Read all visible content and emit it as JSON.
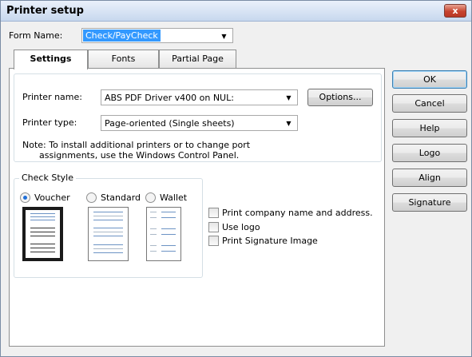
{
  "window": {
    "title": "Printer setup",
    "close_label": "x"
  },
  "form_name": {
    "label": "Form Name:",
    "value": "Check/PayCheck"
  },
  "tabs": [
    {
      "label": "Settings",
      "active": true
    },
    {
      "label": "Fonts",
      "active": false
    },
    {
      "label": "Partial Page",
      "active": false
    }
  ],
  "printer": {
    "name_label": "Printer name:",
    "name_value": "ABS PDF Driver v400 on NUL:",
    "type_label": "Printer type:",
    "type_value": "Page-oriented (Single sheets)",
    "options_label": "Options...",
    "note_line1": "Note: To install additional printers or to change port",
    "note_line2": "assignments, use the Windows Control Panel."
  },
  "check_style": {
    "caption": "Check Style",
    "options": [
      {
        "label": "Voucher",
        "selected": true
      },
      {
        "label": "Standard",
        "selected": false
      },
      {
        "label": "Wallet",
        "selected": false
      }
    ]
  },
  "checkboxes": [
    {
      "label": "Print company name and address.",
      "checked": false
    },
    {
      "label": "Use logo",
      "checked": false
    },
    {
      "label": "Print Signature Image",
      "checked": false
    }
  ],
  "buttons": {
    "ok": "OK",
    "cancel": "Cancel",
    "help": "Help",
    "logo": "Logo",
    "align": "Align",
    "signature": "Signature"
  },
  "colors": {
    "selection": "#3399ff",
    "close_button": "#c7432f"
  }
}
